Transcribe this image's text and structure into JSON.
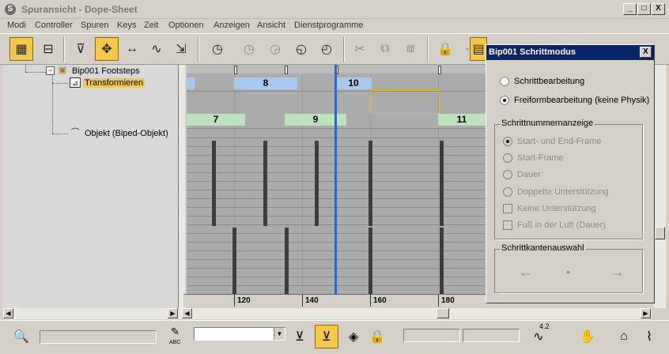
{
  "window": {
    "title": "Spuransicht - Dope-Sheet",
    "app_icon": "S",
    "minimize": "_",
    "maximize": "□",
    "close": "X"
  },
  "menu": [
    "Modi",
    "Controller",
    "Spuren",
    "Keys",
    "Zeit",
    "Optionen",
    "Anzeigen",
    "Ansicht",
    "Dienstprogramme"
  ],
  "toolbar": {
    "icons": [
      "edit-keys-icon",
      "edit-ranges-icon",
      "filter-icon",
      "move-keys-icon",
      "slide-keys-icon",
      "add-keys-icon",
      "scale-keys-icon",
      "time-select-icon",
      "delete-time-icon",
      "reverse-time-icon",
      "scale-time-icon",
      "insert-time-icon",
      "cut-icon",
      "copy-icon",
      "paste-icon",
      "lock-icon",
      "snap-icon",
      "modify-subtree-icon",
      "show-keyable-icon"
    ]
  },
  "tree": {
    "items": [
      {
        "label": "Bip001 Footsteps",
        "icon": "footsteps-icon",
        "expander": "−"
      },
      {
        "label": "Transformieren",
        "icon": "transform-icon",
        "selected": true
      },
      {
        "label": "Objekt (Biped-Objekt)",
        "icon": "biped-object-icon"
      }
    ]
  },
  "dopesheet": {
    "steps_top": [
      {
        "label": "8"
      },
      {
        "label": "10"
      }
    ],
    "steps_bottom": [
      {
        "label": "7"
      },
      {
        "label": "9"
      },
      {
        "label": "11"
      }
    ],
    "ruler": [
      "120",
      "140",
      "160",
      "180"
    ]
  },
  "dialog": {
    "title": "Bip001 Schrittmodus",
    "close": "X",
    "mode_options": [
      {
        "label": "Schrittbearbeitung",
        "checked": false
      },
      {
        "label": "Freiformbearbeitung (keine Physik)",
        "checked": true
      }
    ],
    "number_group": {
      "title": "Schrittnummernanzeige",
      "radios": [
        {
          "label": "Start- und End-Frame",
          "checked": true
        },
        {
          "label": "Start-Frame",
          "checked": false
        },
        {
          "label": "Dauer",
          "checked": false
        },
        {
          "label": "Doppelte Unterstützung",
          "checked": false
        }
      ],
      "checks": [
        {
          "label": "Keine Unterstützung"
        },
        {
          "label": "Fuß in der Luft (Dauer)"
        }
      ]
    },
    "edge_group": {
      "title": "Schrittkantenauswahl",
      "left": "←",
      "center": "•",
      "right": "→"
    }
  },
  "bottom": {
    "abc_label": "ABC",
    "value_label": "4.2"
  }
}
